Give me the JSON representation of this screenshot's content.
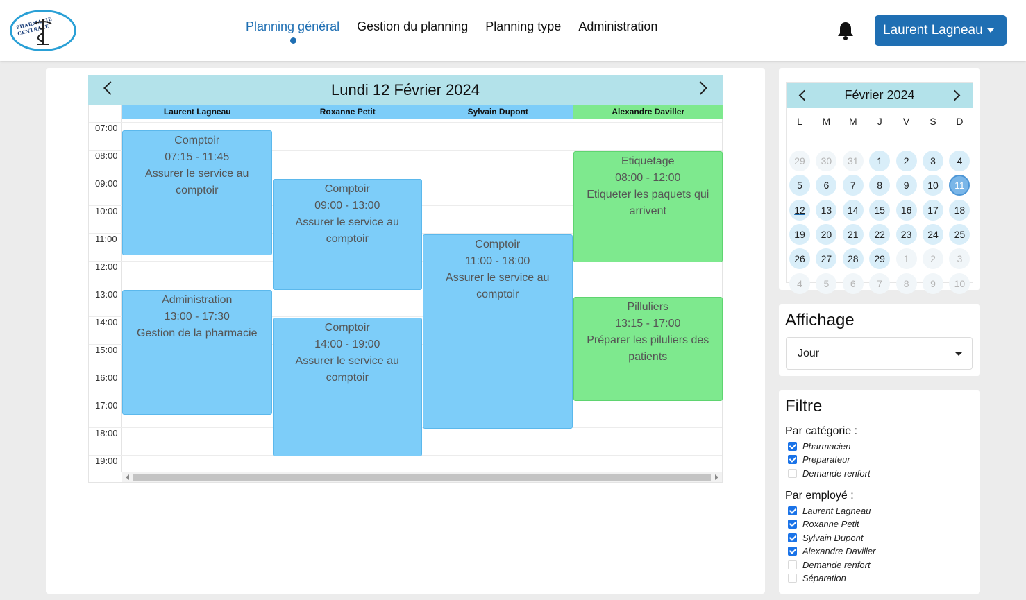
{
  "logo": {
    "text": "PHARMACIE CENTRALE"
  },
  "nav": {
    "items": [
      {
        "label": "Planning général",
        "active": true
      },
      {
        "label": "Gestion du planning",
        "active": false
      },
      {
        "label": "Planning type",
        "active": false
      },
      {
        "label": "Administration",
        "active": false
      }
    ]
  },
  "user": {
    "name": "Laurent Lagneau"
  },
  "planning": {
    "day_title": "Lundi 12 Février 2024",
    "employees": [
      {
        "name": "Laurent Lagneau",
        "color": "#7dcdf9"
      },
      {
        "name": "Roxanne Petit",
        "color": "#7dcdf9"
      },
      {
        "name": "Sylvain Dupont",
        "color": "#7dcdf9"
      },
      {
        "name": "Alexandre Daviller",
        "color": "#7ee98e"
      }
    ],
    "hours": [
      "07:00",
      "08:00",
      "09:00",
      "10:00",
      "11:00",
      "12:00",
      "13:00",
      "14:00",
      "15:00",
      "16:00",
      "17:00",
      "18:00",
      "19:00"
    ],
    "events": [
      {
        "employee": 0,
        "title": "Comptoir",
        "time": "07:15 - 11:45",
        "desc": "Assurer le service au comptoir",
        "color": "blue",
        "start": 7.25,
        "end": 11.75
      },
      {
        "employee": 0,
        "title": "Administration",
        "time": "13:00 - 17:30",
        "desc": "Gestion de la pharmacie",
        "color": "blue",
        "start": 13.0,
        "end": 17.5
      },
      {
        "employee": 1,
        "title": "Comptoir",
        "time": "09:00 - 13:00",
        "desc": "Assurer le service au comptoir",
        "color": "blue",
        "start": 9.0,
        "end": 13.0
      },
      {
        "employee": 1,
        "title": "Comptoir",
        "time": "14:00 - 19:00",
        "desc": "Assurer le service au comptoir",
        "color": "blue",
        "start": 14.0,
        "end": 19.0
      },
      {
        "employee": 2,
        "title": "Comptoir",
        "time": "11:00 - 18:00",
        "desc": "Assurer le service au comptoir",
        "color": "blue",
        "start": 11.0,
        "end": 18.0
      },
      {
        "employee": 3,
        "title": "Etiquetage",
        "time": "08:00 - 12:00",
        "desc": "Etiqueter les paquets qui arrivent",
        "color": "green",
        "start": 8.0,
        "end": 12.0
      },
      {
        "employee": 3,
        "title": "Pilluliers",
        "time": "13:15 - 17:00",
        "desc": "Préparer les piluliers des patients",
        "color": "green",
        "start": 13.25,
        "end": 17.0
      }
    ]
  },
  "mini_calendar": {
    "title": "Février 2024",
    "weekdays": [
      "L",
      "M",
      "M",
      "J",
      "V",
      "S",
      "D"
    ],
    "weeks": [
      [
        {
          "d": "29",
          "m": 1
        },
        {
          "d": "30",
          "m": 1
        },
        {
          "d": "31",
          "m": 1
        },
        {
          "d": "1"
        },
        {
          "d": "2"
        },
        {
          "d": "3"
        },
        {
          "d": "4"
        }
      ],
      [
        {
          "d": "5"
        },
        {
          "d": "6"
        },
        {
          "d": "7"
        },
        {
          "d": "8"
        },
        {
          "d": "9"
        },
        {
          "d": "10"
        },
        {
          "d": "11",
          "sel": 1
        }
      ],
      [
        {
          "d": "12",
          "today": 1
        },
        {
          "d": "13"
        },
        {
          "d": "14"
        },
        {
          "d": "15"
        },
        {
          "d": "16"
        },
        {
          "d": "17"
        },
        {
          "d": "18"
        }
      ],
      [
        {
          "d": "19"
        },
        {
          "d": "20"
        },
        {
          "d": "21"
        },
        {
          "d": "22"
        },
        {
          "d": "23"
        },
        {
          "d": "24"
        },
        {
          "d": "25"
        }
      ],
      [
        {
          "d": "26"
        },
        {
          "d": "27"
        },
        {
          "d": "28"
        },
        {
          "d": "29"
        },
        {
          "d": "1",
          "m": 1
        },
        {
          "d": "2",
          "m": 1
        },
        {
          "d": "3",
          "m": 1
        }
      ],
      [
        {
          "d": "4",
          "m": 1
        },
        {
          "d": "5",
          "m": 1
        },
        {
          "d": "6",
          "m": 1
        },
        {
          "d": "7",
          "m": 1
        },
        {
          "d": "8",
          "m": 1
        },
        {
          "d": "9",
          "m": 1
        },
        {
          "d": "10",
          "m": 1
        }
      ]
    ]
  },
  "affichage": {
    "title": "Affichage",
    "value": "Jour"
  },
  "filtre": {
    "title": "Filtre",
    "par_categorie": {
      "label": "Par catégorie :",
      "items": [
        {
          "label": "Pharmacien",
          "checked": true
        },
        {
          "label": "Preparateur",
          "checked": true
        },
        {
          "label": "Demande renfort",
          "checked": false
        }
      ]
    },
    "par_employe": {
      "label": "Par employé :",
      "items": [
        {
          "label": "Laurent Lagneau",
          "checked": true
        },
        {
          "label": "Roxanne Petit",
          "checked": true
        },
        {
          "label": "Sylvain Dupont",
          "checked": true
        },
        {
          "label": "Alexandre Daviller",
          "checked": true
        },
        {
          "label": "Demande renfort",
          "checked": false
        },
        {
          "label": "Séparation",
          "checked": false
        }
      ]
    }
  }
}
